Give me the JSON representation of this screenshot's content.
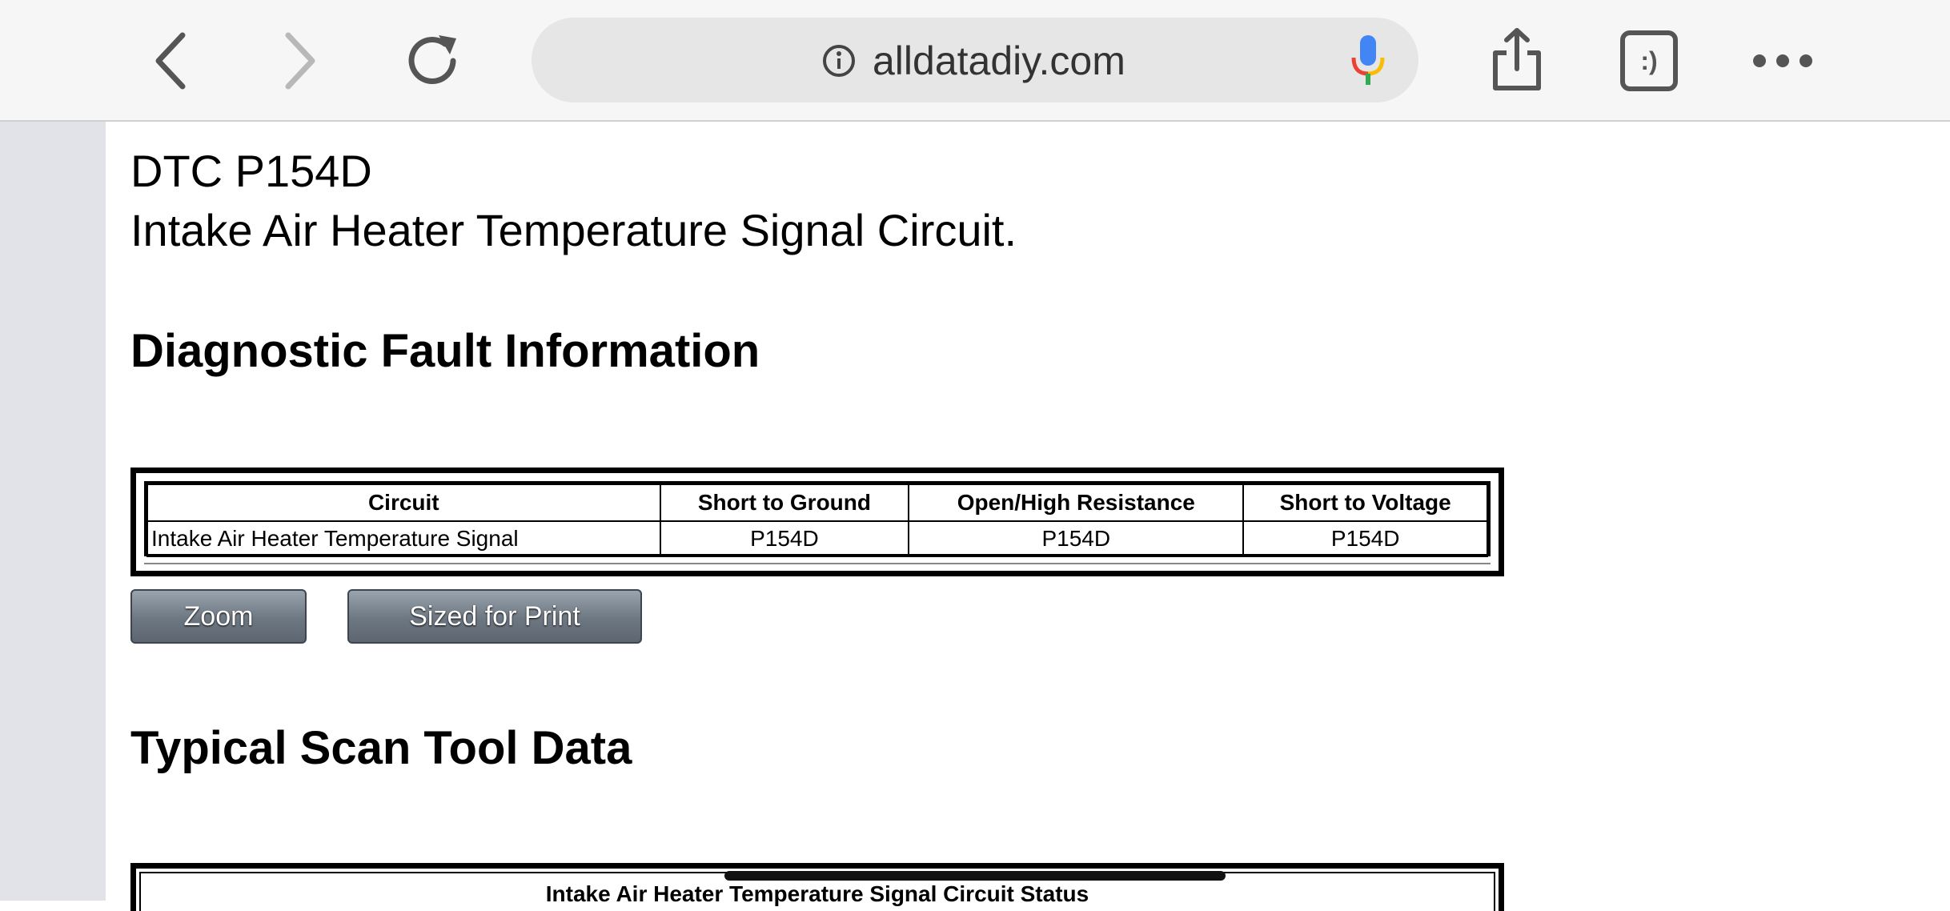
{
  "browser": {
    "url": "alldatadiy.com",
    "icons": {
      "back": "back-arrow-icon",
      "forward": "forward-arrow-icon",
      "reload": "reload-icon",
      "info": "info-icon",
      "mic": "microphone-icon",
      "share": "share-icon",
      "tabs_label": ":)",
      "more": "more-icon"
    }
  },
  "document": {
    "dtc_code": "DTC P154D",
    "dtc_description": "Intake Air Heater Temperature Signal Circuit.",
    "section1_heading": "Diagnostic Fault Information",
    "fault_table": {
      "headers": [
        "Circuit",
        "Short to Ground",
        "Open/High Resistance",
        "Short to Voltage"
      ],
      "rows": [
        [
          "Intake Air Heater Temperature Signal",
          "P154D",
          "P154D",
          "P154D"
        ]
      ]
    },
    "buttons": {
      "zoom": "Zoom",
      "print": "Sized for Print"
    },
    "section2_heading": "Typical Scan Tool Data",
    "table2_title": "Intake Air Heater Temperature Signal Circuit Status"
  },
  "colors": {
    "toolbar_bg": "#f6f6f6",
    "address_bar_bg": "#e6e6e6",
    "gutter_bg": "#e1e3e8",
    "button_gradient_top": "#9aa4ae",
    "button_gradient_bottom": "#5d6670"
  }
}
